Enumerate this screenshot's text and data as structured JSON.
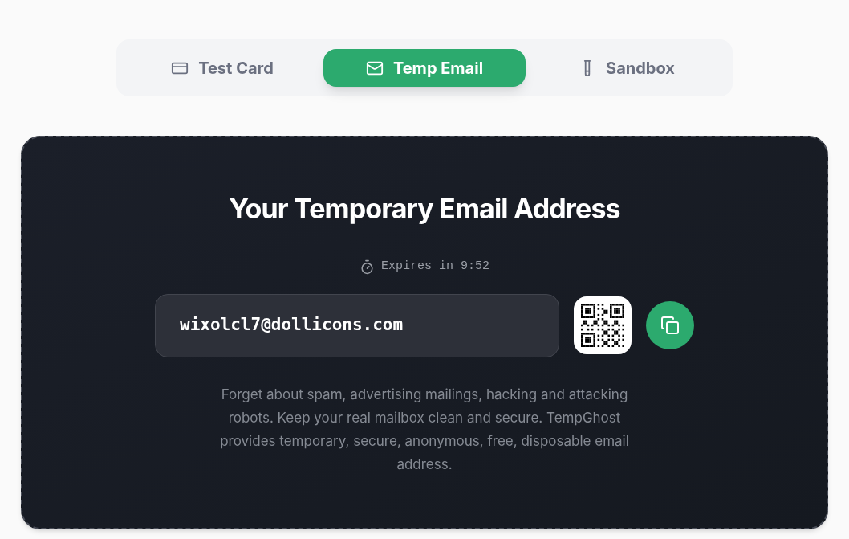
{
  "tabs": [
    {
      "label": "Test Card",
      "selected": false
    },
    {
      "label": "Temp Email",
      "selected": true
    },
    {
      "label": "Sandbox",
      "selected": false
    }
  ],
  "card": {
    "title": "Your Temporary Email Address",
    "expiry": "Expires in 9:52",
    "email": "wixolcl7@dollicons.com",
    "description": "Forget about spam, advertising mailings, hacking and attacking robots. Keep your real mailbox clean and secure. TempGhost provides temporary, secure, anonymous, free, disposable email address."
  }
}
